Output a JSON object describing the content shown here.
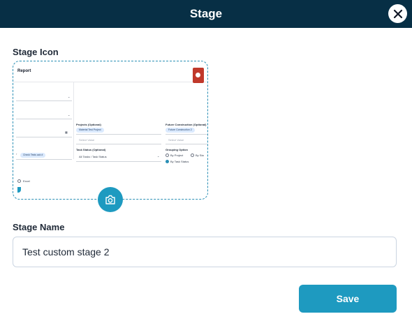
{
  "header": {
    "title": "Stage"
  },
  "icon_section": {
    "label": "Stage Icon",
    "preview": {
      "title": "Report",
      "projects_label": "Projects (Optional)",
      "projects_chip": "Material Test Project",
      "projects_placeholder": "Select Value",
      "future_label": "Future Construction (Optional)",
      "future_chip": "Future Construction 2",
      "future_placeholder": "Select Value",
      "task_status_label": "Task Status (Optional)",
      "task_status_value": "All Tasks / Task Status",
      "left_chip": "Check Tests ack #",
      "grouping_label": "Grouping Option",
      "grouping_options": [
        "By Project",
        "By Sta",
        "By Task Status"
      ],
      "left_radio_label": "Excel"
    }
  },
  "name_section": {
    "label": "Stage Name",
    "value": "Test custom stage 2"
  },
  "actions": {
    "save_label": "Save"
  },
  "colors": {
    "header_bg": "#072f45",
    "accent": "#1e9ac0",
    "danger": "#c0392b"
  }
}
